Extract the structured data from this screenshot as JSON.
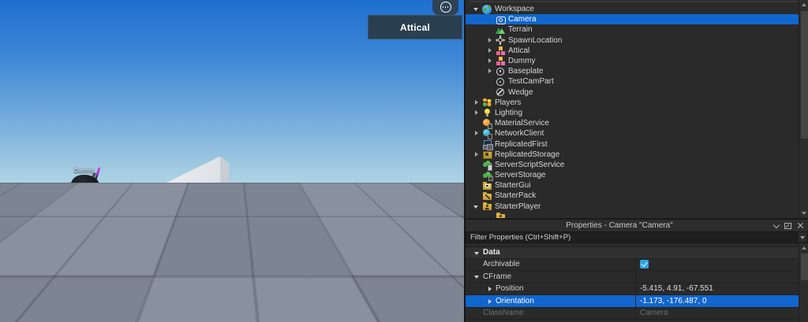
{
  "viewport": {
    "attical_label": "Attical",
    "dummy_label": "Dummy",
    "sky_top_color": "#1e6fd0",
    "sky_horizon_color": "#aed3e4",
    "ground_color": "#848b99",
    "selection_color": "#1166cd"
  },
  "explorer": {
    "items": [
      {
        "label": "Workspace",
        "icon": "globe",
        "level": 0,
        "arrow": "down",
        "selected": false
      },
      {
        "label": "Camera",
        "icon": "camera",
        "level": 1,
        "arrow": null,
        "selected": true
      },
      {
        "label": "Terrain",
        "icon": "terrain",
        "level": 1,
        "arrow": null,
        "selected": false
      },
      {
        "label": "SpawnLocation",
        "icon": "gear",
        "level": 1,
        "arrow": "right",
        "selected": false
      },
      {
        "label": "Attical",
        "icon": "model",
        "level": 1,
        "arrow": "right",
        "selected": false
      },
      {
        "label": "Dummy",
        "icon": "model",
        "level": 1,
        "arrow": "right",
        "selected": false
      },
      {
        "label": "Baseplate",
        "icon": "part",
        "level": 1,
        "arrow": "right",
        "selected": false
      },
      {
        "label": "TestCamPart",
        "icon": "part",
        "level": 1,
        "arrow": null,
        "selected": false
      },
      {
        "label": "Wedge",
        "icon": "wedge",
        "level": 1,
        "arrow": null,
        "selected": false
      },
      {
        "label": "Players",
        "icon": "players",
        "level": 0,
        "arrow": "right",
        "selected": false
      },
      {
        "label": "Lighting",
        "icon": "bulb",
        "level": 0,
        "arrow": "right",
        "selected": false
      },
      {
        "label": "MaterialService",
        "icon": "material",
        "level": 0,
        "arrow": null,
        "selected": false
      },
      {
        "label": "NetworkClient",
        "icon": "network",
        "level": 0,
        "arrow": "right",
        "selected": false
      },
      {
        "label": "ReplicatedFirst",
        "icon": "repfirst",
        "level": 0,
        "arrow": null,
        "selected": false
      },
      {
        "label": "ReplicatedStorage",
        "icon": "repstorage",
        "level": 0,
        "arrow": "right",
        "selected": false
      },
      {
        "label": "ServerScriptService",
        "icon": "cloud-script",
        "level": 0,
        "arrow": null,
        "selected": false
      },
      {
        "label": "ServerStorage",
        "icon": "cloud",
        "level": 0,
        "arrow": null,
        "selected": false
      },
      {
        "label": "StarterGui",
        "icon": "folder-gui",
        "level": 0,
        "arrow": null,
        "selected": false
      },
      {
        "label": "StarterPack",
        "icon": "folder-pack",
        "level": 0,
        "arrow": null,
        "selected": false
      },
      {
        "label": "StarterPlayer",
        "icon": "folder-player",
        "level": 0,
        "arrow": "down",
        "selected": false
      },
      {
        "label": "",
        "icon": "folder-player",
        "level": 1,
        "arrow": null,
        "selected": false
      }
    ]
  },
  "properties": {
    "title": "Properties - Camera \"Camera\"",
    "filter_placeholder": "Filter Properties (Ctrl+Shift+P)",
    "rows": [
      {
        "kind": "section",
        "label": "Data",
        "arrow": "down",
        "indent": 0
      },
      {
        "kind": "row",
        "label": "Archivable",
        "arrow": null,
        "indent": 0,
        "value": {
          "type": "checkbox",
          "checked": true
        }
      },
      {
        "kind": "row",
        "label": "CFrame",
        "arrow": "down",
        "indent": 0,
        "value": null
      },
      {
        "kind": "row",
        "label": "Position",
        "arrow": "right",
        "indent": 1,
        "value": {
          "type": "text",
          "text": "-5.415, 4.91, -67.551"
        }
      },
      {
        "kind": "row",
        "label": "Orientation",
        "arrow": "right",
        "indent": 1,
        "value": {
          "type": "text",
          "text": "-1.173, -176.487, 0"
        },
        "selected": true
      },
      {
        "kind": "row",
        "label": "ClassName",
        "arrow": null,
        "indent": 0,
        "value": {
          "type": "text",
          "text": "Camera"
        },
        "disabled": true
      }
    ]
  }
}
